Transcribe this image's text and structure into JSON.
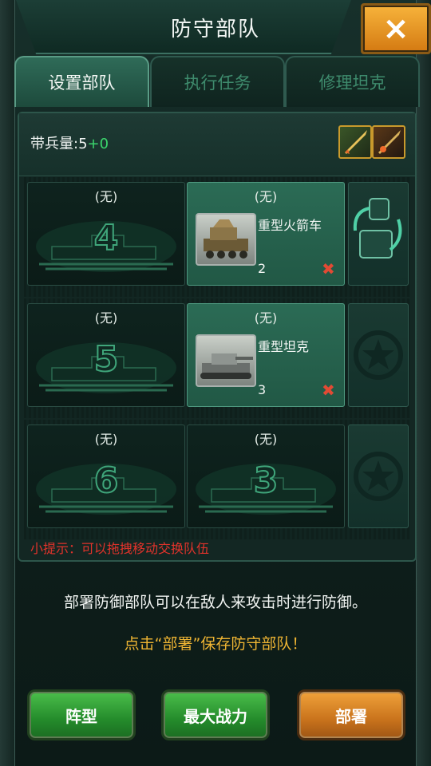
{
  "window": {
    "title": "防守部队",
    "close_label": "×"
  },
  "tabs": [
    {
      "label": "设置部队",
      "active": true
    },
    {
      "label": "执行任务",
      "active": false
    },
    {
      "label": "修理坦克",
      "active": false
    }
  ],
  "troop_capacity": {
    "label": "带兵量:",
    "base": "5",
    "bonus": "+0"
  },
  "item_icons": [
    "rocket-item-icon",
    "missile-item-icon"
  ],
  "rows": [
    {
      "slots": [
        {
          "label": "(无)",
          "number": "4",
          "empty": true
        },
        {
          "label": "(无)",
          "empty": false,
          "unit_name": "重型火箭车",
          "count": "2"
        }
      ],
      "side": "swap-icon"
    },
    {
      "slots": [
        {
          "label": "(无)",
          "number": "5",
          "empty": true
        },
        {
          "label": "(无)",
          "empty": false,
          "unit_name": "重型坦克",
          "count": "3"
        }
      ],
      "side": "star-emblem-icon"
    },
    {
      "slots": [
        {
          "label": "(无)",
          "number": "6",
          "empty": true
        },
        {
          "label": "(无)",
          "number": "3",
          "empty": true
        }
      ],
      "side": "star-emblem-icon"
    }
  ],
  "hint": "小提示：可以拖拽移动交换队伍",
  "description": "部署防御部队可以在敌人来攻击时进行防御。",
  "save_tip": "点击“部署”保存防守部队！",
  "buttons": {
    "formation": "阵型",
    "max_power": "最大战力",
    "deploy": "部署"
  },
  "remove_mark": "✖",
  "colors": {
    "accent_green": "#3bd56c",
    "hint_red": "#e2332b",
    "tip_gold": "#efb533",
    "deploy_orange": "#d47a12"
  }
}
